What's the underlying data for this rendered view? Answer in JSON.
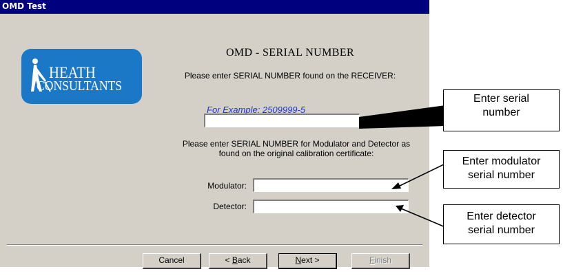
{
  "window": {
    "title": "OMD Test"
  },
  "logo": {
    "line1": "HEATH",
    "line2": "CONSULTANTS"
  },
  "heading": "OMD - SERIAL NUMBER",
  "receiver_prompt": "Please enter SERIAL NUMBER found on the RECEIVER:",
  "example": "For Example: 2509999-5",
  "receiver_field": {
    "value": ""
  },
  "calibration_prompt": "Please enter SERIAL NUMBER for Modulator and Detector as found on the original calibration certificate:",
  "modulator": {
    "label": "Modulator:",
    "value": ""
  },
  "detector": {
    "label": "Detector:",
    "value": ""
  },
  "buttons": {
    "cancel": "Cancel",
    "back_prefix": "< ",
    "back_mnemonic": "B",
    "back_rest": "ack",
    "next_mnemonic": "N",
    "next_rest": "ext >",
    "finish_mnemonic": "F",
    "finish_rest": "inish",
    "finish_enabled": false
  },
  "callouts": {
    "serial": {
      "line1": "Enter serial",
      "line2": "number"
    },
    "modulator": {
      "line1": "Enter modulator",
      "line2": "serial number"
    },
    "detector": {
      "line1": "Enter detector",
      "line2": "serial number"
    }
  },
  "colors": {
    "titlebar": "#00007f",
    "dialog_face": "#d4d0c8",
    "logo_blue": "#1a78c6",
    "example_text": "#1f33d8"
  }
}
